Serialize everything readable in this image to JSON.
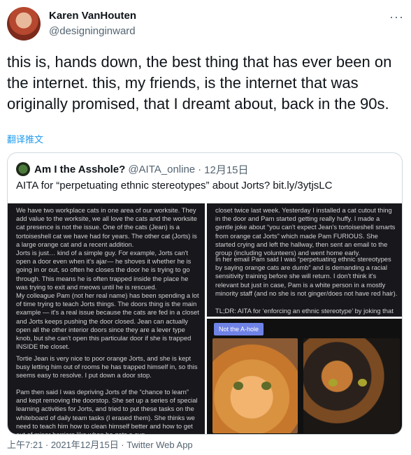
{
  "author": {
    "name": "Karen VanHouten",
    "handle": "@designinginward"
  },
  "tweet": {
    "text": "this is, hands down, the best thing that has ever been on the internet. this, my friends, is the internet that was originally promised, that I dreamt about, back in the 90s.",
    "translate_label": "翻译推文"
  },
  "quote": {
    "name": "Am I the Asshole?",
    "handle": "@AITA_online",
    "separator": "·",
    "date": "12月15日",
    "text": "AITA for “perpetuating ethnic stereotypes” about Jorts?  bit.ly/3ytjsLC",
    "image_left_paragraphs": [
      "We have two workplace cats in one area of our worksite. They add value to the worksite, we all love the cats and the worksite cat presence is not the issue. One of the cats (Jean) is a tortoiseshell cat we have had for years. The other cat (Jorts) is a large orange cat and a recent addition.",
      "Jorts is just… kind of a simple guy. For example, Jorts can't open a door even when it's ajar— he shoves it whether he is going in or out, so often he closes the door he is trying to go through. This means he is often trapped inside the place he was trying to exit and meows until he is rescued.",
      "My colleague Pam (not her real name) has been spending a lot of time trying to teach Jorts things. The doors thing is the main example — it's a real issue because the cats are fed in a closet and Jorts keeps pushing the door closed. Jean can actually open all the other interior doors since they are a lever type knob, but she can't open this particular door if she is trapped INSIDE the closet.",
      "Tortie Jean is very nice to poor orange Jorts, and she is kept busy letting him out of rooms he has trapped himself in, so this seems easy to resolve. I put down a door stop.",
      "Pam then said I was depriving Jorts of the “chance to learn” and kept removing the doorstop. She set up a series of special learning activities for Jorts, and tried to put these tasks on the whiteboard of daily team tasks (I erased them). She thinks we need to teach him how to clean himself better and how to get out of minor barriers like when he gets a cup"
    ],
    "image_right_paragraphs": [
      "closet twice last week. Yesterday I installed a cat cutout thing in the door and Pam started getting really huffy. I made a gentle joke about “you can't expect Jean's tortoiseshell smarts from orange cat Jorts” which made Pam FURIOUS. She started crying and left the hallway, then sent an email to the group (including volunteers) and went home early.",
      "In her email Pam said I was “perpetuating ethnic stereotypes by saying orange cats are dumb” and is demanding a racial sensitivity training before she will return. I don't think it's relevant but just in case, Pam is a white person in a mostly minority staff (and no she is not ginger/does not have red hair).",
      "TL;DR: AITA for ‘enforcing an ethnic stereotype’ by joking that"
    ],
    "verdict_badge": "Not the A-hole"
  },
  "footer": {
    "meta": "上午7:21 · 2021年12月15日 · Twitter Web App"
  },
  "icons": {
    "more": "more-icon"
  }
}
